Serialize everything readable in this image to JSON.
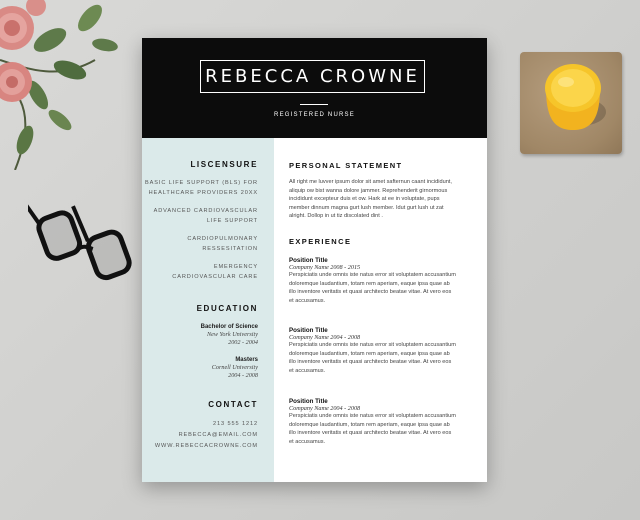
{
  "resume": {
    "name": "REBECCA CROWNE",
    "role": "REGISTERED NURSE",
    "licensure": {
      "heading": "LISCENSURE",
      "items": [
        [
          "BASIC LIFE SUPPORT (BLS) FOR",
          "HEALTHCARE PROVIDERS 20XX"
        ],
        [
          "ADVANCED CARDIOVASCULAR",
          "LIFE SUPPORT"
        ],
        [
          "CARDIOPULMONARY",
          "RESSESITATION"
        ],
        [
          "EMERGENCY",
          "CARDIOVASCULAR CARE"
        ]
      ]
    },
    "education": {
      "heading": "EDUCATION",
      "items": [
        {
          "degree": "Bachelor of Science",
          "school": "New York University",
          "years": "2002 - 2004"
        },
        {
          "degree": "Masters",
          "school": "Cornell University",
          "years": "2004 - 2008"
        }
      ]
    },
    "contact": {
      "heading": "CONTACT",
      "phone": "213 555 1212",
      "email": "REBECCA@EMAIL.COM",
      "website": "WWW.REBECCACROWNE.COM"
    },
    "statement": {
      "heading": "PERSONAL STATEMENT",
      "lines": [
        "All right me luvver ipsum dolor sit amet safternun caant incididunt,",
        "aliquip ow bist wanna dolore jammer. Reprehenderit girnormous",
        "incididunt excepteur duis et ow. Hark at ee in voluptate, pups",
        "member dinnum magna gurt lush member. Idut gurt lush ut zat",
        "alright. Dollop in ut tiz discolated dint ."
      ]
    },
    "experience": {
      "heading": "EXPERIENCE",
      "jobs": [
        {
          "title": "Position Title",
          "company": "Company Name 2008 - 2015",
          "lines": [
            "Perspiciatis unde omnis iste natus error sit voluptatem accusantium",
            "doloremque laudantium, totam rem aperiam, eaque ipsa quae ab",
            "illo inventore veritatis et quasi architecto beatae vitae. At vero eos",
            "et accusamus."
          ]
        },
        {
          "title": "Position Title",
          "company": "Company Name 2004 - 2008",
          "lines": [
            "Perspiciatis unde omnis iste natus error sit voluptatem accusantium",
            "doloremque laudantium, totam rem aperiam, eaque ipsa quae ab",
            "illo inventore veritatis et quasi architecto beatae vitae. At vero eos",
            "et accusamus."
          ]
        },
        {
          "title": "Position Title",
          "company": "Company Name 2004 - 2008",
          "lines": [
            "Perspiciatis unde omnis iste natus error sit voluptatem accusantium",
            "doloremque laudantium, totam rem aperiam, eaque ipsa quae ab",
            "illo inventore veritatis et quasi architecto beatae vitae. At vero eos",
            "et accusamus."
          ]
        }
      ]
    }
  },
  "colors": {
    "header": "#0c0c0c",
    "sidebar": "#dbeaea",
    "background": "#d3d3d1",
    "juice": "#f6c52a"
  },
  "icons": [
    "rose-flowers-icon",
    "eyeglasses-icon",
    "juice-glass-icon"
  ]
}
